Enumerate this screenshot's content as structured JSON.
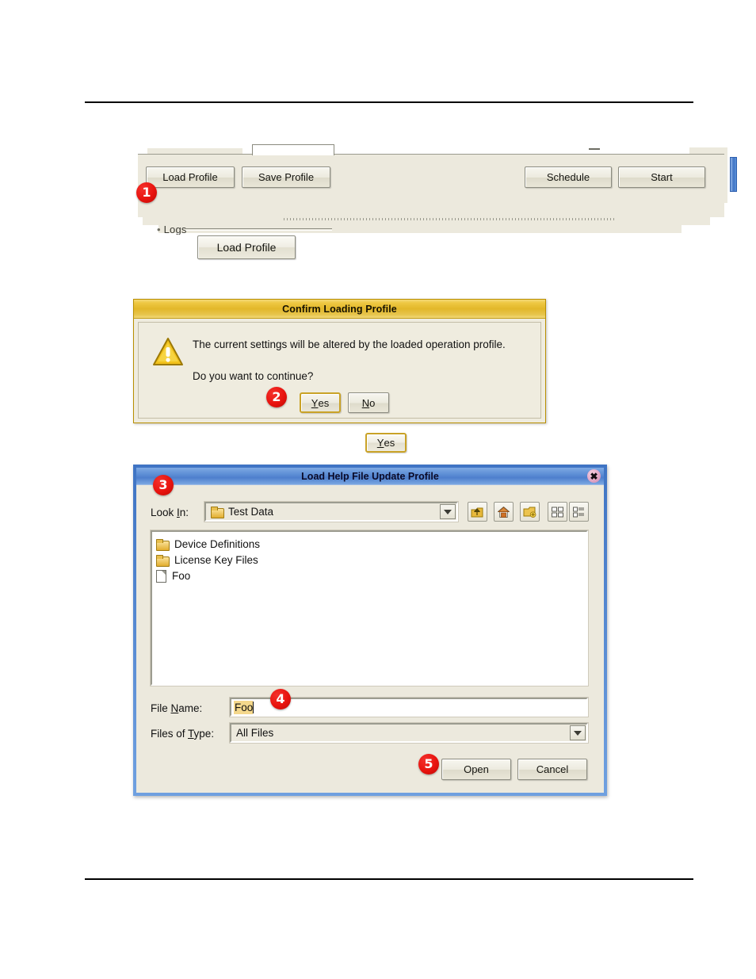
{
  "figure1": {
    "toolbar_buttons": [
      {
        "label": "Load Profile"
      },
      {
        "label": "Save Profile"
      },
      {
        "label": "Schedule"
      },
      {
        "label": "Start"
      }
    ],
    "group_label_fragment": "Logs",
    "callout_button": "Load Profile",
    "badge": "1"
  },
  "confirm_dialog": {
    "title": "Confirm Loading Profile",
    "message_line1": "The current settings will be altered by the loaded operation profile.",
    "message_line2": "Do you want to continue?",
    "yes_label_prefix": "",
    "yes_mnemonic": "Y",
    "yes_label_rest": "es",
    "no_mnemonic": "N",
    "no_label_rest": "o",
    "warning_icon": "warning-triangle-icon",
    "badge": "2"
  },
  "standalone_yes": {
    "mnemonic": "Y",
    "rest": "es"
  },
  "file_dialog": {
    "title": "Load Help File Update Profile",
    "close_icon": "close-icon",
    "look_in_label_prefix": "Look ",
    "look_in_mnemonic": "I",
    "look_in_label_rest": "n:",
    "look_in_value": "Test Data",
    "toolbar_icons": [
      {
        "name": "up-one-level-icon"
      },
      {
        "name": "home-icon"
      },
      {
        "name": "new-folder-icon"
      },
      {
        "name": "list-view-icon"
      },
      {
        "name": "details-view-icon"
      }
    ],
    "files": [
      {
        "name": "Device Definitions",
        "type": "folder"
      },
      {
        "name": "License Key Files",
        "type": "folder"
      },
      {
        "name": "Foo",
        "type": "file"
      }
    ],
    "file_name_label_prefix": "File ",
    "file_name_mnemonic": "N",
    "file_name_label_rest": "ame:",
    "file_name_value": "Foo",
    "files_of_type_label_prefix": "Files of ",
    "files_of_type_mnemonic": "T",
    "files_of_type_label_rest": "ype:",
    "files_of_type_value": "All Files",
    "open_label": "Open",
    "cancel_label": "Cancel",
    "badge_dialog": "3",
    "badge_filename": "4",
    "badge_open": "5"
  }
}
